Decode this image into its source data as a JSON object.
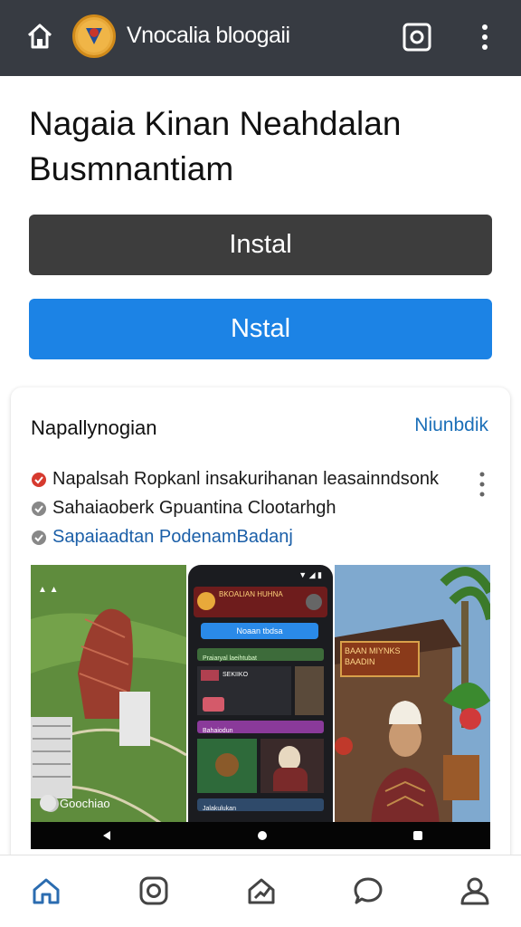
{
  "header": {
    "app_title": "Vnocalia bloogaii",
    "icons": [
      "home-icon",
      "logo-emblem",
      "camera-icon",
      "more-vertical-icon"
    ]
  },
  "main": {
    "headline": "Nagaia Kinan Neahdalan Busmnantiam",
    "primary_button": "Instal",
    "secondary_button": "Nstal"
  },
  "card": {
    "title": "Napallynogian",
    "link": "Niunbdik",
    "items": [
      {
        "text": "Napalsah Ropkanl insakurihanan leasainndsonk",
        "status": "red"
      },
      {
        "text": "Sahaiaoberk Gpuantina Clootarhgh",
        "status": "gray"
      },
      {
        "text": "Sapaiaadtan PodenamBadanj",
        "status": "gray"
      }
    ],
    "screenshots": {
      "left_caption": "Goochiao",
      "phone_header": "BKOALIAN HUHNA",
      "phone_button": "Noaan tbdsa",
      "phone_list": [
        "Praiaryal laeihtubat",
        "SEKIIKO",
        "Bahaiodun",
        "Jalakulukan"
      ],
      "right_sign": "BAAN MIYNKS BAADIN"
    }
  },
  "bottom_nav": [
    "home-nav-icon",
    "instagram-nav-icon",
    "charts-nav-icon",
    "chat-nav-icon",
    "profile-nav-icon"
  ],
  "colors": {
    "header_bg": "#373b42",
    "primary_button": "#3d3d3d",
    "secondary_button": "#1c83e5",
    "link": "#1b6fb8",
    "check_red": "#d63a2f",
    "check_gray": "#888888"
  }
}
